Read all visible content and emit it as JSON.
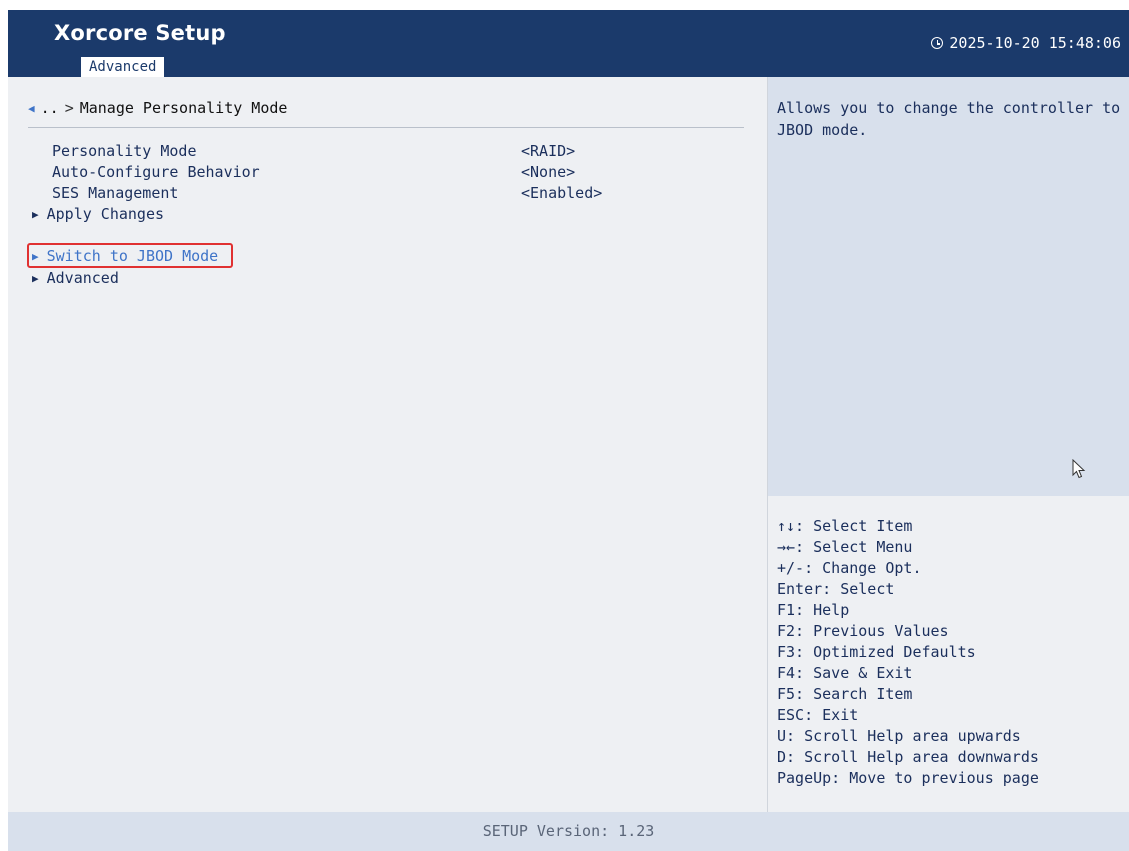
{
  "app": {
    "title": "Xorcore Setup",
    "tab": "Advanced",
    "datetime": "2025-10-20 15:48:06"
  },
  "breadcrumb": {
    "parent": "..",
    "current": "Manage Personality Mode"
  },
  "settings": [
    {
      "label": "Personality Mode",
      "value": "<RAID>"
    },
    {
      "label": "Auto-Configure Behavior",
      "value": "<None>"
    },
    {
      "label": "SES Management",
      "value": "<Enabled>"
    }
  ],
  "submenus": [
    {
      "label": "Apply Changes"
    },
    {
      "label": "Switch to JBOD Mode"
    },
    {
      "label": "Advanced"
    }
  ],
  "help": {
    "text": "Allows you to change the controller to JBOD mode."
  },
  "keys": [
    "↑↓: Select Item",
    "→←: Select Menu",
    "+/-: Change Opt.",
    "Enter: Select",
    "F1: Help",
    "F2: Previous Values",
    "F3: Optimized Defaults",
    "F4: Save & Exit",
    "F5: Search Item",
    "ESC: Exit",
    "U: Scroll Help area upwards",
    "D: Scroll Help area downwards",
    "PageUp: Move to previous page"
  ],
  "footer": {
    "version": "SETUP Version: 1.23"
  },
  "colors": {
    "header_bg": "#1b3a6b",
    "selected": "#3f74c8",
    "highlight_border": "#e03131",
    "help_bg": "#d8e0ec",
    "main_bg": "#eef0f3"
  },
  "icons": {
    "clock": "clock-icon",
    "back": "back-arrow-icon",
    "submenu": "triangle-right-icon",
    "cursor": "mouse-pointer-icon"
  }
}
